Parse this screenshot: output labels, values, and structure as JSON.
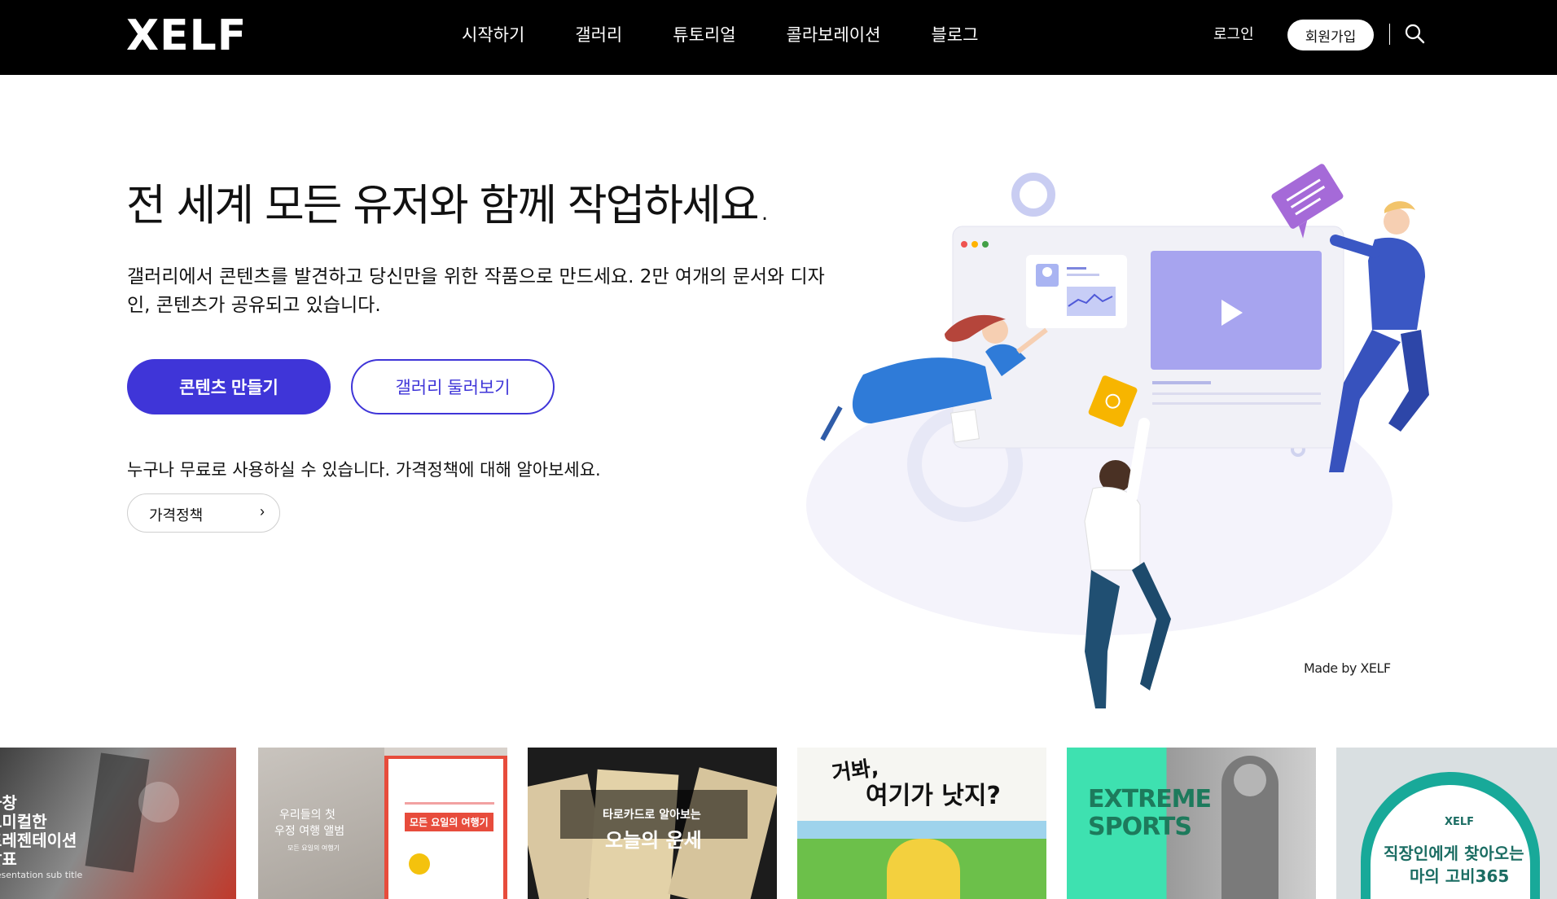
{
  "header": {
    "logo": "XELF",
    "nav": [
      "시작하기",
      "갤러리",
      "튜토리얼",
      "콜라보레이션",
      "블로그"
    ],
    "login": "로그인",
    "signup": "회원가입",
    "search_icon": "search-icon"
  },
  "hero": {
    "title": "전 세계 모든 유저와 함께 작업하세요.",
    "description": "갤러리에서 콘텐츠를 발견하고 당신만을 위한 작품으로 만드세요. 2만 여개의 문서와 디자인, 콘텐츠가 공유되고 있습니다.",
    "primary_button": "콘텐츠 만들기",
    "secondary_button": "갤러리 둘러보기",
    "free_text": "누구나 무료로 사용하실 수 있습니다. 가격정책에 대해 알아보세요.",
    "pricing_button": "가격정책",
    "made_by": "Made by XELF"
  },
  "cards": [
    {
      "lines": [
        "차창",
        "드미컬한",
        "프레젠테이션",
        "발표"
      ],
      "sub": "Presentation sub title"
    },
    {
      "left_title": "우리들의 첫",
      "left_title2": "우정 여행 앨범",
      "left_small": "모든 요일의 여행기",
      "badge": "모든 요일의 여행기"
    },
    {
      "small": "타로카드로 알아보는",
      "big": "오늘의 운세"
    },
    {
      "title1": "거봐,",
      "title2": "여기가 낫지?"
    },
    {
      "line1": "EXTREME",
      "line2": "SPORTS"
    },
    {
      "brand": "XELF",
      "l1": "직장인에게 찾아오는",
      "l2": "마의 고비365"
    }
  ],
  "colors": {
    "accent": "#3f35d8",
    "header_bg": "#000000"
  }
}
